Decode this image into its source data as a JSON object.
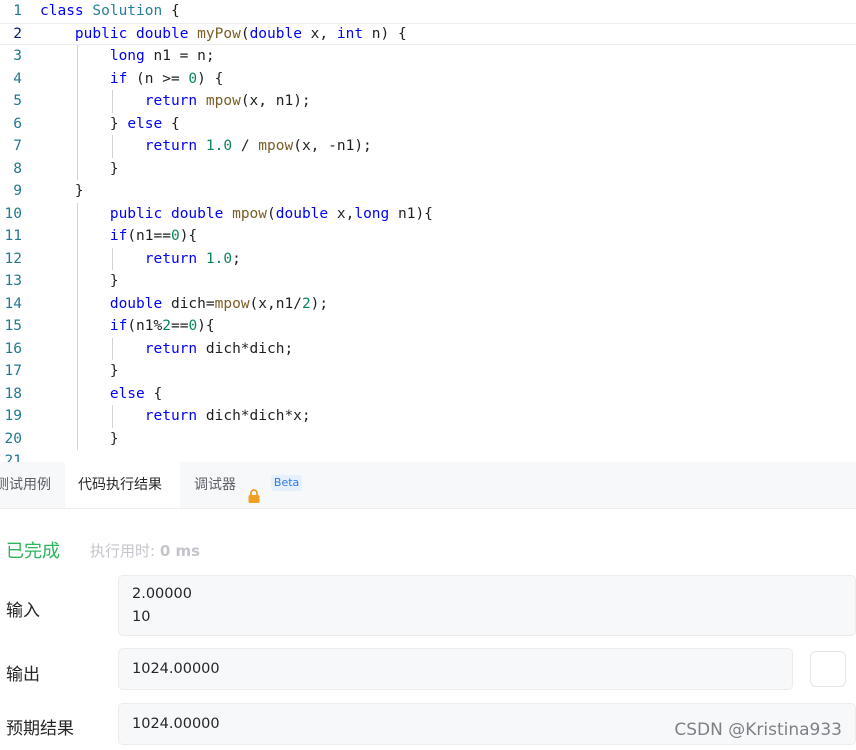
{
  "editor": {
    "lines": [
      {
        "n": "1",
        "text": "class Solution {"
      },
      {
        "n": "2",
        "text": "    public double myPow(double x, int n) {"
      },
      {
        "n": "3",
        "text": "        long n1 = n;"
      },
      {
        "n": "4",
        "text": "        if (n >= 0) {"
      },
      {
        "n": "5",
        "text": "            return mpow(x, n1);"
      },
      {
        "n": "6",
        "text": "        } else {"
      },
      {
        "n": "7",
        "text": "            return 1.0 / mpow(x, -n1);"
      },
      {
        "n": "8",
        "text": "        }"
      },
      {
        "n": "9",
        "text": "    }"
      },
      {
        "n": "10",
        "text": "        public double mpow(double x,long n1){"
      },
      {
        "n": "11",
        "text": "        if(n1==0){"
      },
      {
        "n": "12",
        "text": "            return 1.0;"
      },
      {
        "n": "13",
        "text": "        }"
      },
      {
        "n": "14",
        "text": "        double dich=mpow(x,n1/2);"
      },
      {
        "n": "15",
        "text": "        if(n1%2==0){"
      },
      {
        "n": "16",
        "text": "            return dich*dich;"
      },
      {
        "n": "17",
        "text": "        }"
      },
      {
        "n": "18",
        "text": "        else {"
      },
      {
        "n": "19",
        "text": "            return dich*dich*x;"
      },
      {
        "n": "20",
        "text": "        }"
      },
      {
        "n": "21",
        "text": ""
      }
    ]
  },
  "tabs": {
    "testcase": "测试用例",
    "result": "代码执行结果",
    "debugger": "调试器",
    "beta": "Beta"
  },
  "result": {
    "status": "已完成",
    "time_label": "执行用时:",
    "time_value": "0 ms",
    "input_label": "输入",
    "input_lines": [
      "2.00000",
      "10"
    ],
    "output_label": "输出",
    "output_value": "1024.00000",
    "expected_label": "预期结果",
    "expected_value": "1024.00000"
  },
  "watermark": "CSDN @Kristina933",
  "colors": {
    "success": "#2db55d",
    "line_number": "#237893",
    "keyword": "#0000ff",
    "type": "#267f99",
    "function": "#795e26",
    "number": "#098658",
    "beta_badge": "#2d7be5",
    "lock": "#f0a020"
  }
}
